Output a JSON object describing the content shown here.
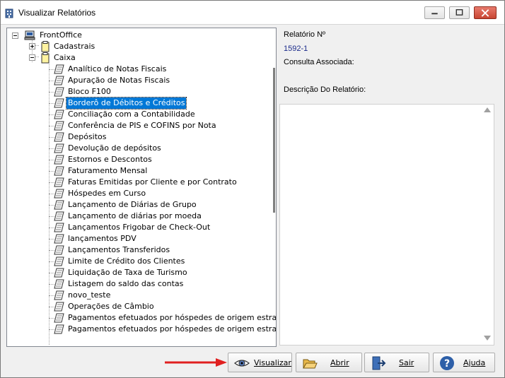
{
  "window": {
    "title": "Visualizar Relatórios",
    "controls": [
      "minimize",
      "maximize",
      "close"
    ]
  },
  "tree": {
    "root": {
      "label": "FrontOffice",
      "icon": "computer-icon",
      "expanded": true
    },
    "groups": [
      {
        "label": "Cadastrais",
        "icon": "folder-icon",
        "expanded": false
      },
      {
        "label": "Caixa",
        "icon": "folder-icon",
        "expanded": true
      }
    ],
    "items": [
      "Analítico de Notas Fiscais",
      "Apuração de Notas Fiscais",
      "Bloco F100",
      "Borderô de Débitos e Créditos",
      "Conciliação com a Contabilidade",
      "Conferência de PIS e COFINS por Nota",
      "Depósitos",
      "Devolução de depósitos",
      "Estornos e Descontos",
      "Faturamento Mensal",
      "Faturas Emitidas por Cliente e por Contrato",
      "Hóspedes em Curso",
      "Lançamento de Diárias de Grupo",
      "Lançamento de diárias por moeda",
      "Lançamentos Frigobar de Check-Out",
      "lançamentos PDV",
      "Lançamentos Transferidos",
      "Limite de Crédito dos Clientes",
      "Liquidação de Taxa de Turismo",
      "Listagem do saldo das contas",
      "novo_teste",
      "Operações de Câmbio",
      "Pagamentos efetuados por hóspedes de origem estra",
      "Pagamentos efetuados por hóspedes de origem estra"
    ],
    "selected_index": 3,
    "item_icon": "report-icon"
  },
  "details": {
    "report_number_label": "Relatório Nº",
    "report_number_value": "1592-1",
    "query_label": "Consulta Associada:",
    "description_label": "Descrição Do Relatório:"
  },
  "buttons": {
    "view": "Visualizar",
    "open": "Abrir",
    "exit": "Sair",
    "help": "Ajuda"
  },
  "colors": {
    "selection": "#0078d7",
    "value_text": "#1a2a8a",
    "annotation_arrow": "#e02020"
  }
}
